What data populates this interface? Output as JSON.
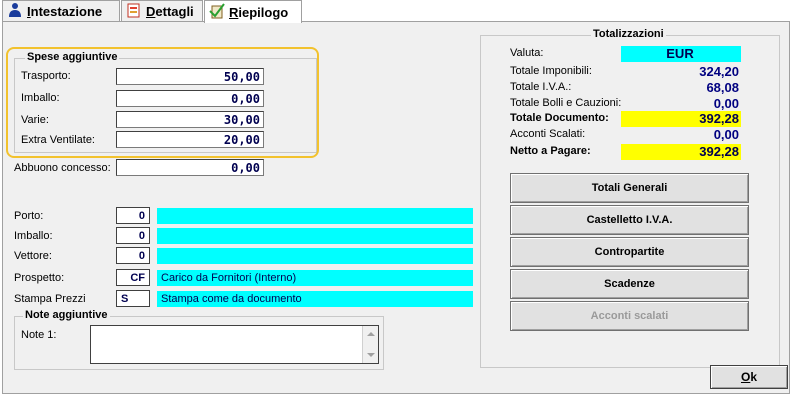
{
  "tabs": [
    {
      "label_prefix": "",
      "underline": "I",
      "rest": "ntestazione",
      "icon": "person-icon"
    },
    {
      "label_prefix": "",
      "underline": "D",
      "rest": "ettagli",
      "icon": "document-icon"
    },
    {
      "label_prefix": "",
      "underline": "R",
      "rest": "iepilogo",
      "icon": "summary-icon"
    }
  ],
  "spese": {
    "title": "Spese aggiuntive",
    "rows": [
      {
        "label": "Trasporto:",
        "value": "50,00"
      },
      {
        "label": "Imballo:",
        "value": "0,00"
      },
      {
        "label": "Varie:",
        "value": "30,00"
      },
      {
        "label": "Extra Ventilate:",
        "value": "20,00"
      }
    ]
  },
  "abbuono": {
    "label": "Abbuono concesso:",
    "value": "0,00"
  },
  "codes": [
    {
      "label": "Porto:",
      "code": "0",
      "desc": ""
    },
    {
      "label": "Imballo:",
      "code": "0",
      "desc": ""
    },
    {
      "label": "Vettore:",
      "code": "0",
      "desc": ""
    },
    {
      "label": "Prospetto:",
      "code": "CF",
      "desc": "Carico da Fornitori (Interno)"
    },
    {
      "label": "Stampa Prezzi",
      "code": "S",
      "desc": "Stampa come da documento"
    }
  ],
  "note": {
    "title": "Note aggiuntive",
    "label": "Note 1:",
    "value": ""
  },
  "totalizzazioni": {
    "title": "Totalizzazioni",
    "rows": [
      {
        "label": "Valuta:",
        "value": "EUR"
      },
      {
        "label": "Totale Imponibili:",
        "value": "324,20"
      },
      {
        "label": "Totale I.V.A.:",
        "value": "68,08"
      },
      {
        "label": "Totale Bolli e Cauzioni:",
        "value": "0,00"
      },
      {
        "label": "Totale Documento:",
        "value": "392,28"
      },
      {
        "label": "Acconti Scalati:",
        "value": "0,00"
      },
      {
        "label": "Netto a Pagare:",
        "value": "392,28"
      }
    ]
  },
  "buttons": {
    "totali": "Totali Generali",
    "castelletto": "Castelletto I.V.A.",
    "contropartite": "Contropartite",
    "scadenze": "Scadenze",
    "acconti": "Acconti scalati"
  },
  "ok": {
    "underline": "O",
    "rest": "k"
  },
  "colors": {
    "cyan": "#00ffff",
    "yellow": "#ffff00",
    "highlight": "#f2c22e",
    "value_text": "#000080"
  }
}
